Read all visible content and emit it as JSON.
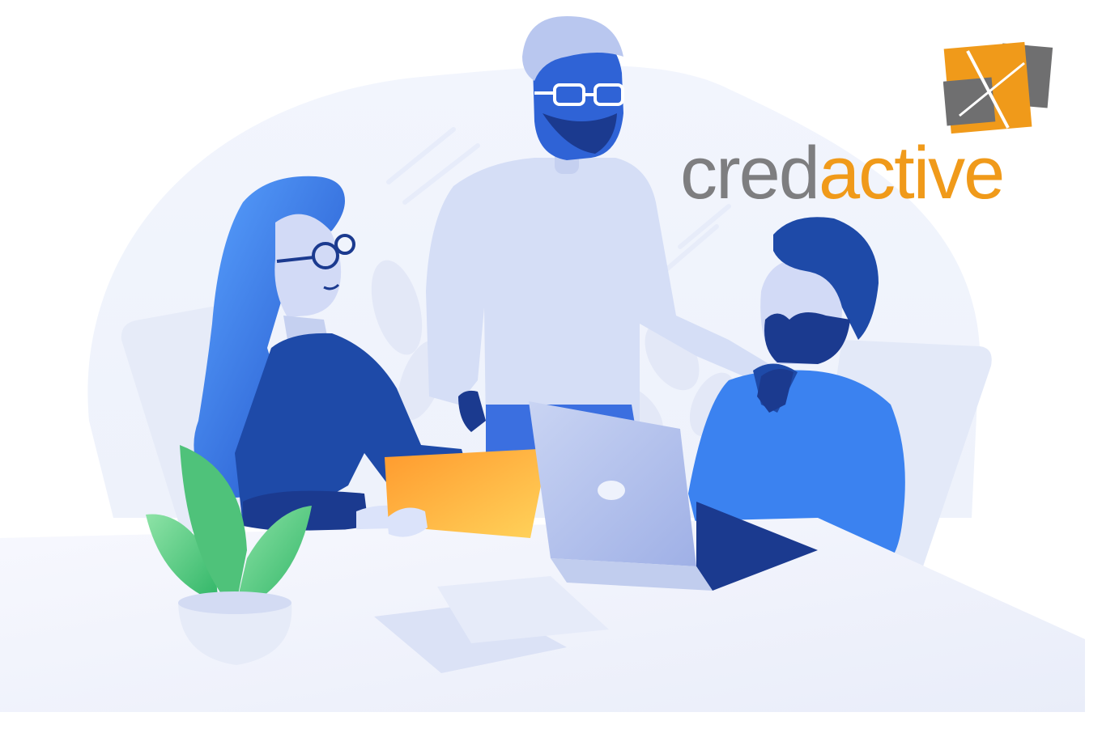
{
  "logo": {
    "word_part1": "cred",
    "word_part2": "active",
    "colors": {
      "gray": "#7e7e80",
      "orange": "#f09a1a",
      "mark_gray": "#6f6f70"
    }
  },
  "illustration": {
    "palette": {
      "blue_dark": "#1b3a8f",
      "blue_mid": "#2f63d6",
      "blue_light": "#4a86ee",
      "lavender": "#d7dff5",
      "folder_orange": "#ffbf3b",
      "plant_green": "#4fc27a"
    }
  }
}
